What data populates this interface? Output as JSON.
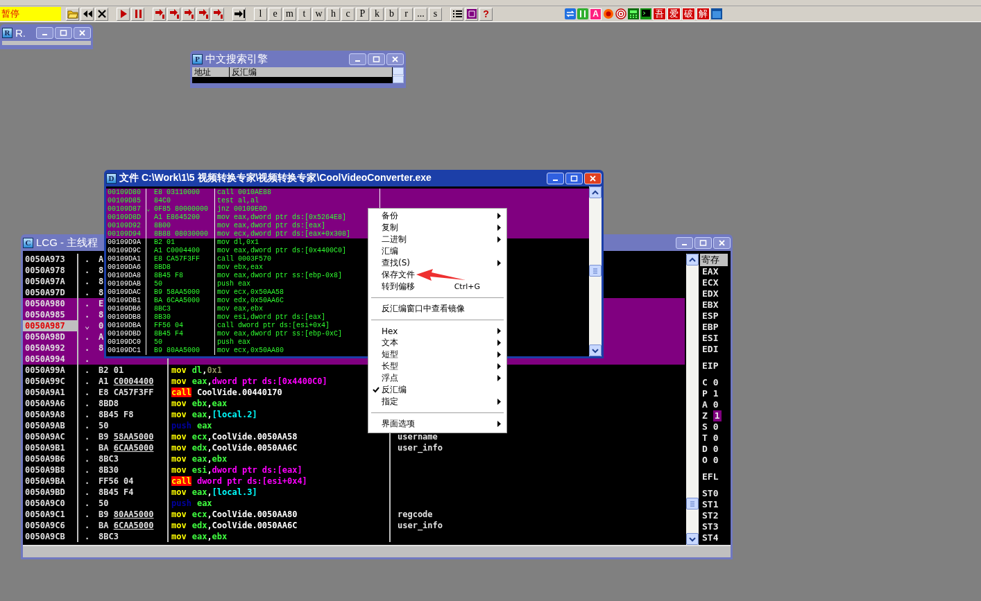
{
  "toolbar": {
    "status": "暂停",
    "letter_buttons": [
      "l",
      "e",
      "m",
      "t",
      "w",
      "h",
      "c",
      "P",
      "k",
      "b",
      "r",
      "...",
      "s"
    ],
    "help": "?",
    "a_key": "A",
    "brand_keys": [
      "吾",
      "爱",
      "破",
      "解"
    ]
  },
  "r_window": {
    "icon_letter": "R",
    "title": "R."
  },
  "search_window": {
    "icon_letter": "P",
    "title": "中文搜索引擎",
    "columns": [
      "地址",
      "反汇编"
    ]
  },
  "lcg_window": {
    "icon_letter": "C",
    "title": "LCG - 主线程",
    "rows": [
      {
        "address": "0050A973",
        "mark": ".",
        "hex": "A",
        "highlighted": false,
        "current": false
      },
      {
        "address": "0050A978",
        "mark": ".",
        "hex": "8",
        "highlighted": false,
        "current": false
      },
      {
        "address": "0050A97A",
        "mark": ".",
        "hex": "8",
        "highlighted": false,
        "current": false
      },
      {
        "address": "0050A97D",
        "mark": ".",
        "hex": "8",
        "highlighted": false,
        "current": false
      },
      {
        "address": "0050A980",
        "mark": ".",
        "hex": "E",
        "highlighted": true,
        "current": false
      },
      {
        "address": "0050A985",
        "mark": ".",
        "hex": "8",
        "highlighted": true,
        "current": false
      },
      {
        "address": "0050A987",
        "mark": "⌄",
        "hex": "0",
        "highlighted": true,
        "current": true
      },
      {
        "address": "0050A98D",
        "mark": ".",
        "hex": "A",
        "highlighted": true,
        "current": false
      },
      {
        "address": "0050A992",
        "mark": ".",
        "hex": "8",
        "highlighted": true,
        "current": false
      },
      {
        "address": "0050A994",
        "mark": ".",
        "highlighted": true,
        "current": false
      },
      {
        "address": "0050A99A",
        "mark": ".",
        "hex": "B2 01",
        "highlighted": false,
        "current": false,
        "asm": [
          {
            "kind": "mn",
            "text": "mov"
          },
          {
            "kind": "reg",
            "text": "dl"
          },
          {
            "kind": "sep",
            "text": ","
          },
          {
            "kind": "imm",
            "text": "0x1"
          }
        ]
      },
      {
        "address": "0050A99C",
        "mark": ".",
        "hex": "A1",
        "reloc": "C0004400",
        "highlighted": false,
        "current": false,
        "asm": [
          {
            "kind": "mn",
            "text": "mov"
          },
          {
            "kind": "reg",
            "text": "eax"
          },
          {
            "kind": "sep",
            "text": ","
          },
          {
            "kind": "mem",
            "text": "dword ptr ds:[0x4400C0]"
          }
        ]
      },
      {
        "address": "0050A9A1",
        "mark": ".",
        "hex": "E8 CA57F3FF",
        "highlighted": false,
        "current": false,
        "asm": [
          {
            "kind": "call",
            "text": "call"
          },
          {
            "kind": "sym",
            "text": "CoolVide.00440170"
          }
        ]
      },
      {
        "address": "0050A9A6",
        "mark": ".",
        "hex": "8BD8",
        "highlighted": false,
        "current": false,
        "asm": [
          {
            "kind": "mn",
            "text": "mov"
          },
          {
            "kind": "reg",
            "text": "ebx"
          },
          {
            "kind": "sep",
            "text": ","
          },
          {
            "kind": "reg",
            "text": "eax"
          }
        ]
      },
      {
        "address": "0050A9A8",
        "mark": ".",
        "hex": "8B45 F8",
        "highlighted": false,
        "current": false,
        "asm": [
          {
            "kind": "mn",
            "text": "mov"
          },
          {
            "kind": "reg",
            "text": "eax"
          },
          {
            "kind": "sep",
            "text": ","
          },
          {
            "kind": "local",
            "text": "[local.2]"
          }
        ]
      },
      {
        "address": "0050A9AB",
        "mark": ".",
        "hex": "50",
        "highlighted": false,
        "current": false,
        "asm": [
          {
            "kind": "push",
            "text": "push"
          },
          {
            "kind": "reg",
            "text": "eax"
          }
        ]
      },
      {
        "address": "0050A9AC",
        "mark": ".",
        "hex": "B9",
        "reloc": "58AA5000",
        "highlighted": false,
        "current": false,
        "asm": [
          {
            "kind": "mn",
            "text": "mov"
          },
          {
            "kind": "reg",
            "text": "ecx"
          },
          {
            "kind": "sep",
            "text": ","
          },
          {
            "kind": "sym",
            "text": "CoolVide.0050AA58"
          }
        ],
        "comment": "username"
      },
      {
        "address": "0050A9B1",
        "mark": ".",
        "hex": "BA",
        "reloc": "6CAA5000",
        "highlighted": false,
        "current": false,
        "asm": [
          {
            "kind": "mn",
            "text": "mov"
          },
          {
            "kind": "reg",
            "text": "edx"
          },
          {
            "kind": "sep",
            "text": ","
          },
          {
            "kind": "sym",
            "text": "CoolVide.0050AA6C"
          }
        ],
        "comment": "user_info"
      },
      {
        "address": "0050A9B6",
        "mark": ".",
        "hex": "8BC3",
        "highlighted": false,
        "current": false,
        "asm": [
          {
            "kind": "mn",
            "text": "mov"
          },
          {
            "kind": "reg",
            "text": "eax"
          },
          {
            "kind": "sep",
            "text": ","
          },
          {
            "kind": "reg",
            "text": "ebx"
          }
        ]
      },
      {
        "address": "0050A9B8",
        "mark": ".",
        "hex": "8B30",
        "highlighted": false,
        "current": false,
        "asm": [
          {
            "kind": "mn",
            "text": "mov"
          },
          {
            "kind": "reg",
            "text": "esi"
          },
          {
            "kind": "sep",
            "text": ","
          },
          {
            "kind": "mem",
            "text": "dword ptr ds:[eax]"
          }
        ]
      },
      {
        "address": "0050A9BA",
        "mark": ".",
        "hex": "FF56 04",
        "highlighted": false,
        "current": false,
        "asm": [
          {
            "kind": "call",
            "text": "call"
          },
          {
            "kind": "mem",
            "text": "dword ptr ds:[esi+0x4]"
          }
        ]
      },
      {
        "address": "0050A9BD",
        "mark": ".",
        "hex": "8B45 F4",
        "highlighted": false,
        "current": false,
        "asm": [
          {
            "kind": "mn",
            "text": "mov"
          },
          {
            "kind": "reg",
            "text": "eax"
          },
          {
            "kind": "sep",
            "text": ","
          },
          {
            "kind": "local",
            "text": "[local.3]"
          }
        ]
      },
      {
        "address": "0050A9C0",
        "mark": ".",
        "hex": "50",
        "highlighted": false,
        "current": false,
        "asm": [
          {
            "kind": "push",
            "text": "push"
          },
          {
            "kind": "reg",
            "text": "eax"
          }
        ]
      },
      {
        "address": "0050A9C1",
        "mark": ".",
        "hex": "B9",
        "reloc": "80AA5000",
        "highlighted": false,
        "current": false,
        "asm": [
          {
            "kind": "mn",
            "text": "mov"
          },
          {
            "kind": "reg",
            "text": "ecx"
          },
          {
            "kind": "sep",
            "text": ","
          },
          {
            "kind": "sym",
            "text": "CoolVide.0050AA80"
          }
        ],
        "comment": "regcode"
      },
      {
        "address": "0050A9C6",
        "mark": ".",
        "hex": "BA",
        "reloc": "6CAA5000",
        "highlighted": false,
        "current": false,
        "asm": [
          {
            "kind": "mn",
            "text": "mov"
          },
          {
            "kind": "reg",
            "text": "edx"
          },
          {
            "kind": "sep",
            "text": ","
          },
          {
            "kind": "sym",
            "text": "CoolVide.0050AA6C"
          }
        ],
        "comment": "user_info"
      },
      {
        "address": "0050A9CB",
        "mark": ".",
        "hex": "8BC3",
        "highlighted": false,
        "current": false,
        "asm": [
          {
            "kind": "mn",
            "text": "mov"
          },
          {
            "kind": "reg",
            "text": "eax"
          },
          {
            "kind": "sep",
            "text": ","
          },
          {
            "kind": "reg",
            "text": "ebx"
          }
        ]
      }
    ],
    "registers": {
      "title": "寄存",
      "general": [
        "EAX",
        "ECX",
        "EDX",
        "EBX",
        "ESP",
        "EBP",
        "ESI",
        "EDI"
      ],
      "eip": "EIP",
      "flags": [
        {
          "name": "C",
          "value": "0",
          "highlighted": false
        },
        {
          "name": "P",
          "value": "1",
          "highlighted": false
        },
        {
          "name": "A",
          "value": "0",
          "highlighted": false
        },
        {
          "name": "Z",
          "value": "1",
          "highlighted": true
        },
        {
          "name": "S",
          "value": "0",
          "highlighted": false
        },
        {
          "name": "T",
          "value": "0",
          "highlighted": false
        },
        {
          "name": "D",
          "value": "0",
          "highlighted": false
        },
        {
          "name": "O",
          "value": "0",
          "highlighted": false
        }
      ],
      "efl": "EFL",
      "fpu": [
        "ST0",
        "ST1",
        "ST2",
        "ST3",
        "ST4"
      ]
    }
  },
  "file_window": {
    "icon_letter": "D",
    "title": "文件 C:\\Work\\1\\5 视频转换专家\\视频转换专家\\CoolVideoConverter.exe",
    "rows": [
      {
        "address": "00109D80",
        "hex": "E8 03110000",
        "asm": "call 0010AE88",
        "highlighted": true
      },
      {
        "address": "00109D85",
        "hex": "84C0",
        "asm": "test al,al",
        "highlighted": true
      },
      {
        "address": "00109D87",
        "mark": "⌄",
        "hex": "0F85 80000000",
        "asm": "jnz 00109E0D",
        "highlighted": true
      },
      {
        "address": "00109D8D",
        "hex": "A1 E8645200",
        "asm": "mov eax,dword ptr ds:[0x5264E8]",
        "highlighted": true
      },
      {
        "address": "00109D92",
        "hex": "8B00",
        "asm": "mov eax,dword ptr ds:[eax]",
        "highlighted": true
      },
      {
        "address": "00109D94",
        "hex": "8B88 08030000",
        "asm": "mov ecx,dword ptr ds:[eax+0x308]",
        "highlighted": true
      },
      {
        "address": "00109D9A",
        "hex": "B2 01",
        "asm": "mov dl,0x1",
        "highlighted": false
      },
      {
        "address": "00109D9C",
        "hex": "A1 C0004400",
        "asm": "mov eax,dword ptr ds:[0x4400C0]",
        "highlighted": false
      },
      {
        "address": "00109DA1",
        "hex": "E8 CA57F3FF",
        "asm": "call 0003F570",
        "highlighted": false
      },
      {
        "address": "00109DA6",
        "hex": "8BD8",
        "asm": "mov ebx,eax",
        "highlighted": false
      },
      {
        "address": "00109DA8",
        "hex": "8B45 F8",
        "asm": "mov eax,dword ptr ss:[ebp-0x8]",
        "highlighted": false
      },
      {
        "address": "00109DAB",
        "hex": "50",
        "asm": "push eax",
        "highlighted": false
      },
      {
        "address": "00109DAC",
        "hex": "B9 58AA5000",
        "asm": "mov ecx,0x50AA58",
        "highlighted": false
      },
      {
        "address": "00109DB1",
        "hex": "BA 6CAA5000",
        "asm": "mov edx,0x50AA6C",
        "highlighted": false
      },
      {
        "address": "00109DB6",
        "hex": "8BC3",
        "asm": "mov eax,ebx",
        "highlighted": false
      },
      {
        "address": "00109DB8",
        "hex": "8B30",
        "asm": "mov esi,dword ptr ds:[eax]",
        "highlighted": false
      },
      {
        "address": "00109DBA",
        "hex": "FF56 04",
        "asm": "call dword ptr ds:[esi+0x4]",
        "highlighted": false
      },
      {
        "address": "00109DBD",
        "hex": "8B45 F4",
        "asm": "mov eax,dword ptr ss:[ebp-0xC]",
        "highlighted": false
      },
      {
        "address": "00109DC0",
        "hex": "50",
        "asm": "push eax",
        "highlighted": false
      },
      {
        "address": "00109DC1",
        "hex": "B9 80AA5000",
        "asm": "mov ecx,0x50AA80",
        "highlighted": false
      }
    ]
  },
  "context_menu": {
    "items": [
      {
        "kind": "item",
        "label": "备份",
        "submenu": true,
        "checked": false
      },
      {
        "kind": "item",
        "label": "复制",
        "submenu": true,
        "checked": false
      },
      {
        "kind": "item",
        "label": "二进制",
        "submenu": true,
        "checked": false
      },
      {
        "kind": "item",
        "label": "汇编",
        "submenu": false,
        "checked": false
      },
      {
        "kind": "item",
        "label": "查找(S)",
        "submenu": true,
        "checked": false
      },
      {
        "kind": "item",
        "label": "保存文件",
        "submenu": false,
        "checked": false
      },
      {
        "kind": "item",
        "label": "转到偏移",
        "submenu": false,
        "checked": false,
        "shortcut": "Ctrl+G"
      },
      {
        "kind": "separator"
      },
      {
        "kind": "item",
        "label": "反汇编窗口中查看镜像",
        "submenu": false,
        "checked": false
      },
      {
        "kind": "separator"
      },
      {
        "kind": "item",
        "label": "Hex",
        "submenu": true,
        "checked": false
      },
      {
        "kind": "item",
        "label": "文本",
        "submenu": true,
        "checked": false
      },
      {
        "kind": "item",
        "label": "短型",
        "submenu": true,
        "checked": false
      },
      {
        "kind": "item",
        "label": "长型",
        "submenu": true,
        "checked": false
      },
      {
        "kind": "item",
        "label": "浮点",
        "submenu": true,
        "checked": false
      },
      {
        "kind": "item",
        "label": "反汇编",
        "submenu": false,
        "checked": true
      },
      {
        "kind": "item",
        "label": "指定",
        "submenu": true,
        "checked": false
      },
      {
        "kind": "separator"
      },
      {
        "kind": "item",
        "label": "界面选项",
        "submenu": true,
        "checked": false
      }
    ]
  }
}
